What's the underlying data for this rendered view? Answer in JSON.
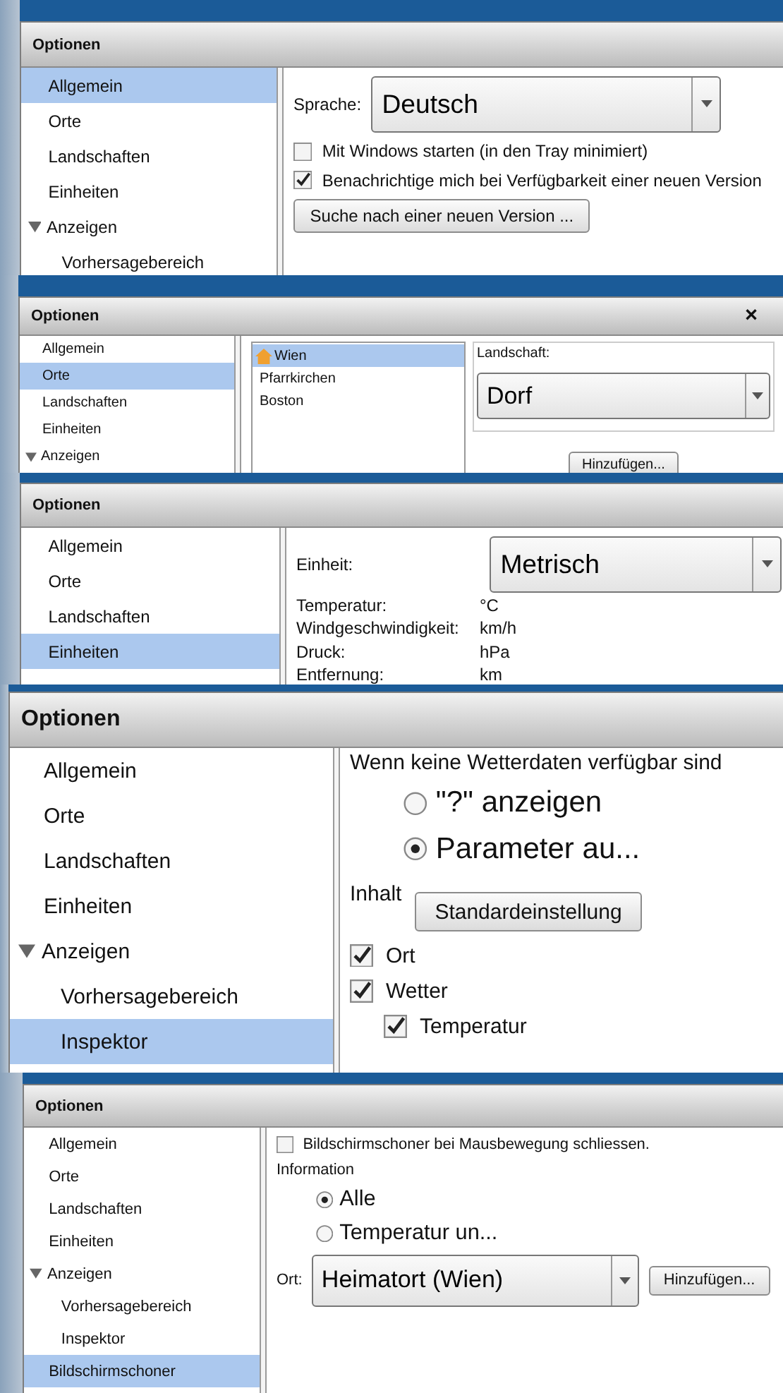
{
  "panels": [
    {
      "title": "Optionen",
      "sidebar": [
        {
          "label": "Allgemein",
          "selected": true
        },
        {
          "label": "Orte",
          "selected": false
        },
        {
          "label": "Landschaften",
          "selected": false
        },
        {
          "label": "Einheiten",
          "selected": false
        },
        {
          "label": "Anzeigen",
          "selected": false,
          "expanded": true,
          "children": [
            {
              "label": "Vorhersagebereich",
              "selected": false
            }
          ]
        }
      ],
      "content": [
        {
          "kind": "dropdown",
          "label": "Sprache:",
          "value": "Deutsch"
        },
        {
          "kind": "checkbox",
          "label": "Mit Windows starten (in den Tray minimiert)",
          "checked": false
        },
        {
          "kind": "checkbox",
          "label": "Benachrichtige mich bei Verfügbarkeit einer neuen Version",
          "checked": true
        },
        {
          "kind": "button",
          "label": "Suche nach einer neuen Version ..."
        }
      ]
    },
    {
      "title": "Optionen",
      "close": "×",
      "sidebar": [
        {
          "label": "Allgemein",
          "selected": false
        },
        {
          "label": "Orte",
          "selected": true
        },
        {
          "label": "Landschaften",
          "selected": false
        },
        {
          "label": "Einheiten",
          "selected": false
        },
        {
          "label": "Anzeigen",
          "selected": false,
          "expanded": true
        }
      ],
      "content": [
        {
          "kind": "places",
          "items": [
            {
              "label": "Wien",
              "home": true,
              "selected": true
            },
            {
              "label": "Pfarrkirchen",
              "home": false,
              "selected": false
            },
            {
              "label": "Boston",
              "home": false,
              "selected": false
            }
          ],
          "group_label": "Landschaft:",
          "dropdown": "Dorf",
          "button": "Hinzufügen..."
        }
      ]
    },
    {
      "title": "Optionen",
      "sidebar": [
        {
          "label": "Allgemein",
          "selected": false
        },
        {
          "label": "Orte",
          "selected": false
        },
        {
          "label": "Landschaften",
          "selected": false
        },
        {
          "label": "Einheiten",
          "selected": true
        }
      ],
      "content": [
        {
          "kind": "dropdown",
          "label": "Einheit:",
          "value": "Metrisch"
        },
        {
          "kind": "pair",
          "label": "Temperatur:",
          "value": "°C"
        },
        {
          "kind": "pair",
          "label": "Windgeschwindigkeit:",
          "value": "km/h"
        },
        {
          "kind": "pair",
          "label": "Druck:",
          "value": "hPa"
        },
        {
          "kind": "pair",
          "label": "Entfernung:",
          "value": "km"
        }
      ]
    },
    {
      "title": "Optionen",
      "sidebar": [
        {
          "label": "Allgemein",
          "selected": false
        },
        {
          "label": "Orte",
          "selected": false
        },
        {
          "label": "Landschaften",
          "selected": false
        },
        {
          "label": "Einheiten",
          "selected": false
        },
        {
          "label": "Anzeigen",
          "selected": false,
          "expanded": true,
          "children": [
            {
              "label": "Vorhersagebereich",
              "selected": false
            },
            {
              "label": "Inspektor",
              "selected": true
            }
          ]
        }
      ],
      "content": [
        {
          "kind": "text",
          "label": "Wenn keine Wetterdaten verfügbar sind"
        },
        {
          "kind": "radio",
          "label": "\"?\" anzeigen",
          "selected": false
        },
        {
          "kind": "radio",
          "label": "Parameter au...",
          "selected": true
        },
        {
          "kind": "row",
          "items": [
            {
              "kind": "text",
              "label": "Inhalt"
            },
            {
              "kind": "button",
              "label": "Standardeinstellung"
            }
          ]
        },
        {
          "kind": "checkbox",
          "label": "Ort",
          "checked": true
        },
        {
          "kind": "checkbox",
          "label": "Wetter",
          "checked": true,
          "children": [
            {
              "kind": "checkbox",
              "label": "Temperatur",
              "checked": true
            }
          ]
        }
      ]
    },
    {
      "title": "Optionen",
      "sidebar": [
        {
          "label": "Allgemein",
          "selected": false
        },
        {
          "label": "Orte",
          "selected": false
        },
        {
          "label": "Landschaften",
          "selected": false
        },
        {
          "label": "Einheiten",
          "selected": false
        },
        {
          "label": "Anzeigen",
          "selected": false,
          "expanded": true,
          "children": [
            {
              "label": "Vorhersagebereich",
              "selected": false
            },
            {
              "label": "Inspektor",
              "selected": false
            }
          ]
        },
        {
          "label": "Bildschirmschoner",
          "selected": true
        }
      ],
      "content": [
        {
          "kind": "checkbox",
          "label": "Bildschirmschoner bei Mausbewegung schliessen.",
          "checked": false
        },
        {
          "kind": "text",
          "label": "Information"
        },
        {
          "kind": "radio",
          "label": "Alle",
          "selected": true
        },
        {
          "kind": "radio",
          "label": "Temperatur un...",
          "selected": false
        },
        {
          "kind": "row",
          "items": [
            {
              "kind": "dropdown",
              "label": "Ort:",
              "value": "Heimatort (Wien)"
            },
            {
              "kind": "button",
              "label": "Hinzufügen..."
            }
          ]
        }
      ]
    }
  ]
}
